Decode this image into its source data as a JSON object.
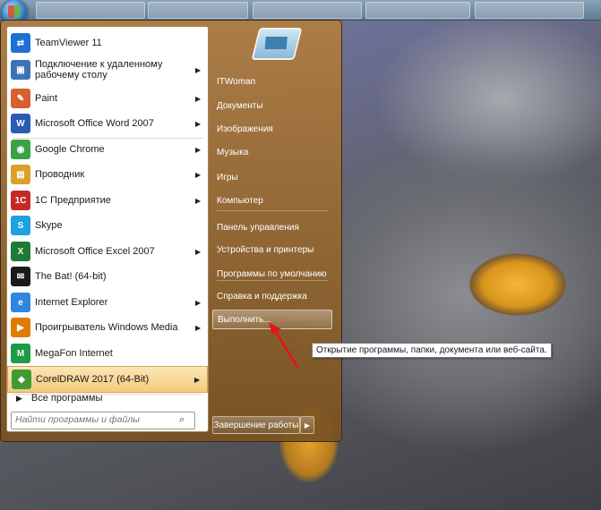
{
  "colors": {
    "menu_accent": "#a87a3e",
    "selection": "#f3c97c",
    "arrow": "#e01818"
  },
  "programs": [
    {
      "label": "TeamViewer 11",
      "icon": "teamviewer-icon",
      "has_submenu": false
    },
    {
      "label": "Подключение к удаленному рабочему столу",
      "icon": "remote-desktop-icon",
      "has_submenu": true
    },
    {
      "label": "Paint",
      "icon": "paint-icon",
      "has_submenu": true
    },
    {
      "label": "Microsoft Office Word 2007",
      "icon": "word-icon",
      "has_submenu": true
    },
    {
      "label": "Google Chrome",
      "icon": "chrome-icon",
      "has_submenu": true
    },
    {
      "label": "Проводник",
      "icon": "explorer-folder-icon",
      "has_submenu": true
    },
    {
      "label": "1С Предприятие",
      "icon": "1c-icon",
      "has_submenu": true
    },
    {
      "label": "Skype",
      "icon": "skype-icon",
      "has_submenu": false
    },
    {
      "label": "Microsoft Office Excel 2007",
      "icon": "excel-icon",
      "has_submenu": true
    },
    {
      "label": "The Bat! (64-bit)",
      "icon": "thebat-icon",
      "has_submenu": false
    },
    {
      "label": "Internet Explorer",
      "icon": "internet-explorer-icon",
      "has_submenu": true
    },
    {
      "label": "Проигрыватель Windows Media",
      "icon": "windows-media-icon",
      "has_submenu": true
    },
    {
      "label": "MegaFon Internet",
      "icon": "megafon-icon",
      "has_submenu": false
    },
    {
      "label": "CorelDRAW 2017 (64-Bit)",
      "icon": "coreldraw-icon",
      "has_submenu": true
    }
  ],
  "all_programs_label": "Все программы",
  "search": {
    "placeholder": "Найти программы и файлы"
  },
  "places": [
    {
      "label": "ITWoman"
    },
    {
      "label": "Документы"
    },
    {
      "label": "Изображения"
    },
    {
      "label": "Музыка"
    },
    {
      "label": "Игры"
    },
    {
      "label": "Компьютер"
    },
    {
      "label": "Панель управления"
    },
    {
      "label": "Устройства и принтеры"
    },
    {
      "label": "Программы по умолчанию"
    },
    {
      "label": "Справка и поддержка"
    },
    {
      "label": "Выполнить..."
    }
  ],
  "shutdown_label": "Завершение работы",
  "tooltip": "Открытие программы, папки, документа или веб-сайта."
}
